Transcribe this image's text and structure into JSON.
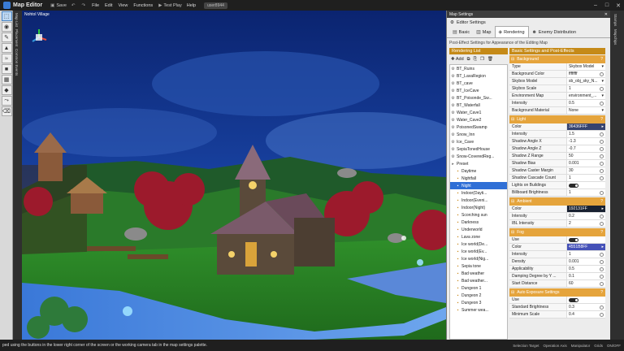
{
  "titlebar": {
    "app_name": "Map Editor",
    "save": "Save",
    "menus": [
      "File",
      "Edit",
      "View",
      "Functions"
    ],
    "test_play": "Test Play",
    "help": "Help",
    "user": "user8944"
  },
  "left_tabs": [
    "Map List",
    "Placement",
    "Common Events"
  ],
  "viewport": {
    "title": "Nohtol Village"
  },
  "settings": {
    "window_title": "Map Settings",
    "editor_title": "Editor Settings",
    "tabs": [
      "Basic",
      "Map",
      "Rendering",
      "Enemy Distribution"
    ],
    "subtitle": "Post-Effect Settings for Appearance of the Editing Map",
    "rendering_list_title": "Rendering List",
    "add_label": "Add",
    "basic_settings_title": "Basic Settings and Post-Effects"
  },
  "rendering_items": [
    {
      "label": "BT_Ruins",
      "child": false
    },
    {
      "label": "BT_LavaRegion",
      "child": false
    },
    {
      "label": "BT_cave",
      "child": false
    },
    {
      "label": "BT_IceCave",
      "child": false
    },
    {
      "label": "BT_Poisonde_Sw...",
      "child": false
    },
    {
      "label": "BT_Waterfall",
      "child": false
    },
    {
      "label": "Water_Cave1",
      "child": false
    },
    {
      "label": "Water_Cave2",
      "child": false
    },
    {
      "label": "PoisonedSwamp",
      "child": false
    },
    {
      "label": "Snow_Inn",
      "child": false
    },
    {
      "label": "Ice_Cave",
      "child": false
    },
    {
      "label": "SepiaTonedHouse",
      "child": false
    },
    {
      "label": "Snow-CoveredReg...",
      "child": false
    },
    {
      "label": "Preset",
      "child": false,
      "folder": true
    },
    {
      "label": "Daytime",
      "child": true
    },
    {
      "label": "Nightfall",
      "child": true
    },
    {
      "label": "Night",
      "child": true,
      "selected": true
    },
    {
      "label": "Indoor(Dayti...",
      "child": true
    },
    {
      "label": "Indoor(Eveni...",
      "child": true
    },
    {
      "label": "Indoor(Night)",
      "child": true
    },
    {
      "label": "Scorching sun",
      "child": true
    },
    {
      "label": "Darkness",
      "child": true
    },
    {
      "label": "Underworld",
      "child": true
    },
    {
      "label": "Lava zone",
      "child": true
    },
    {
      "label": "Ice world(De...",
      "child": true
    },
    {
      "label": "Ice world(Ev...",
      "child": true
    },
    {
      "label": "Ice world(Nig...",
      "child": true
    },
    {
      "label": "Sepia tone",
      "child": true
    },
    {
      "label": "Bad weather",
      "child": true
    },
    {
      "label": "Bad weather...",
      "child": true
    },
    {
      "label": "Dungeon 1",
      "child": true
    },
    {
      "label": "Dungeon 2",
      "child": true
    },
    {
      "label": "Dungeon 3",
      "child": true
    },
    {
      "label": "Summer wea...",
      "child": true
    }
  ],
  "sections": [
    {
      "title": "Background",
      "rows": [
        {
          "label": "Type",
          "value": "Skybox Model",
          "kind": "select"
        },
        {
          "label": "Background Color",
          "value": "ffffffff",
          "kind": "color"
        },
        {
          "label": "Skybox Model",
          "value": "sb_obj_sky_N...",
          "kind": "select"
        },
        {
          "label": "Skybox Scale",
          "value": "1",
          "kind": "num"
        },
        {
          "label": "Environment Map",
          "value": "environment_...",
          "kind": "select"
        },
        {
          "label": "Intensity",
          "value": "0.5",
          "kind": "num"
        },
        {
          "label": "Background Material",
          "value": "None",
          "kind": "select"
        }
      ]
    },
    {
      "title": "Light",
      "rows": [
        {
          "label": "Color",
          "value": "36436FFF",
          "kind": "swatch",
          "swatch": "#36436f"
        },
        {
          "label": "Intensity",
          "value": "1.5",
          "kind": "num"
        },
        {
          "label": "Shadow Angle X",
          "value": "-1.3",
          "kind": "num"
        },
        {
          "label": "Shadow Angle Z",
          "value": "-0.7",
          "kind": "num"
        },
        {
          "label": "Shadow Z Range",
          "value": "50",
          "kind": "num"
        },
        {
          "label": "Shadow Bias",
          "value": "0.001",
          "kind": "num"
        },
        {
          "label": "Shadow Caster Margin",
          "value": "30",
          "kind": "num"
        },
        {
          "label": "Shadow Cascade Count",
          "value": "1",
          "kind": "num"
        },
        {
          "label": "Lights on Buildings",
          "value": "",
          "kind": "toggle"
        },
        {
          "label": "Billboard Brightness",
          "value": "1",
          "kind": "num"
        }
      ]
    },
    {
      "title": "Ambient",
      "rows": [
        {
          "label": "Color",
          "value": "192131FF",
          "kind": "swatch",
          "swatch": "#192131"
        },
        {
          "label": "Intensity",
          "value": "0.2",
          "kind": "num"
        },
        {
          "label": "IBL Intensity",
          "value": "2",
          "kind": "num"
        }
      ]
    },
    {
      "title": "Fog",
      "rows": [
        {
          "label": "Use",
          "value": "",
          "kind": "toggle"
        },
        {
          "label": "Color",
          "value": "4551B8FF",
          "kind": "swatch",
          "swatch": "#4551b8"
        },
        {
          "label": "Intensity",
          "value": "1",
          "kind": "num"
        },
        {
          "label": "Density",
          "value": "0.001",
          "kind": "num"
        },
        {
          "label": "Applicability",
          "value": "0.5",
          "kind": "num"
        },
        {
          "label": "Damping Degree by Y ...",
          "value": "0.1",
          "kind": "num"
        },
        {
          "label": "Start Distance",
          "value": "60",
          "kind": "num"
        }
      ]
    },
    {
      "title": "Auto Exposure Settings",
      "rows": [
        {
          "label": "Use",
          "value": "",
          "kind": "toggle"
        },
        {
          "label": "Standard Brightness",
          "value": "0.3",
          "kind": "num"
        },
        {
          "label": "Minimum Scale",
          "value": "0.4",
          "kind": "num"
        }
      ]
    }
  ],
  "right_tabs": [
    "Stamps",
    "Mapchips"
  ],
  "status": {
    "message": "ped using the buttons in the lower right corner of the screen or the working camera tab in the map settings palette.",
    "items": [
      "Selection Target",
      "Operation Axis",
      "Manipulator",
      "Grids",
      "ON/OFF"
    ]
  }
}
